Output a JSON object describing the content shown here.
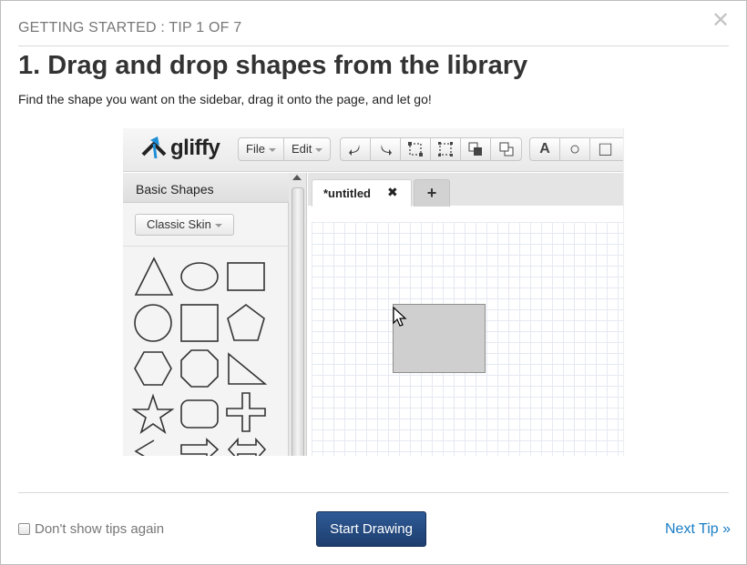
{
  "header": {
    "eyebrow": "GETTING STARTED :  TIP 1 OF 7",
    "close_glyph": "✕",
    "title": "1. Drag and drop shapes from the library",
    "description": "Find the shape you want on the sidebar, drag it onto the page, and let go!"
  },
  "screenshot": {
    "logo_text": "gliffy",
    "menus": [
      {
        "label": "File"
      },
      {
        "label": "Edit"
      }
    ],
    "tools": [
      "undo-icon",
      "redo-icon",
      "group-icon",
      "ungroup-icon",
      "bring-front-icon",
      "send-back-icon"
    ],
    "tools2": [
      {
        "icon": "text-tool-icon",
        "glyph": "A"
      },
      {
        "icon": "ellipse-tool-icon",
        "glyph": "○"
      },
      {
        "icon": "rectangle-tool-icon",
        "glyph": "□"
      }
    ],
    "sidebar": {
      "title": "Basic Shapes",
      "skin_button": "Classic Skin",
      "shapes": [
        "triangle",
        "ellipse",
        "rectangle",
        "circle",
        "square",
        "pentagon",
        "hexagon",
        "octagon",
        "right-triangle",
        "star",
        "rounded-rectangle",
        "cross",
        "arrow-left",
        "arrow-right",
        "arrow-double"
      ]
    },
    "tab": {
      "label": "*untitled",
      "close_glyph": "✖",
      "add_glyph": "+"
    },
    "canvas_shape": "rectangle",
    "accent_colors": {
      "logo_blue": "#1e8fd6",
      "shape_fill": "#cfcfcf"
    }
  },
  "footer": {
    "checkbox_label": "Don't show tips again",
    "checkbox_checked": false,
    "start_button": "Start Drawing",
    "next_link": "Next Tip »"
  }
}
